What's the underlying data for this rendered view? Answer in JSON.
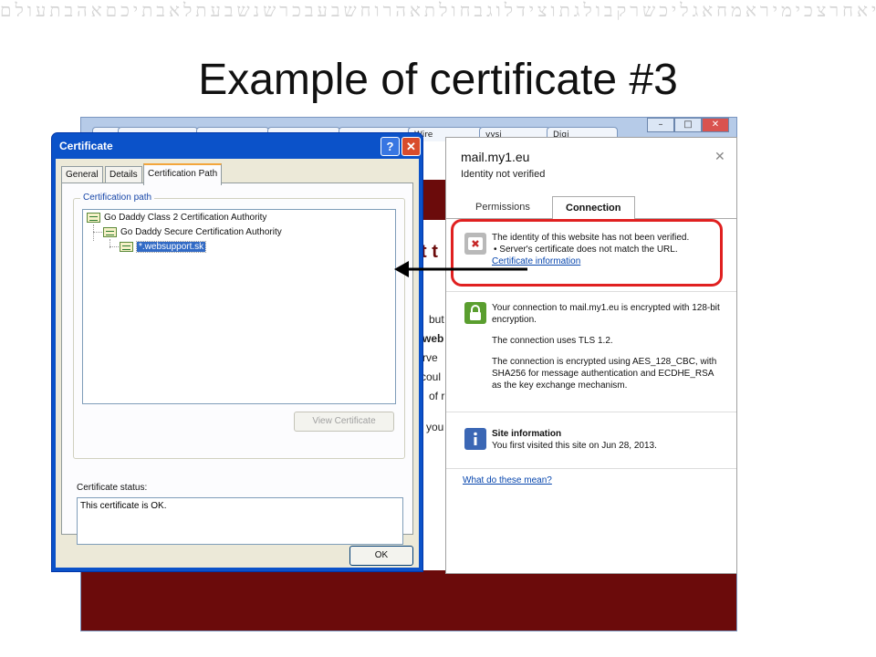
{
  "slide": {
    "title": "Example of certificate #3",
    "background_glyphs": "מרהבכריהאלהצערירההנשבתאמשאתאבכנשקכריבנמלילהרבאשתאתנכהכלאורשבנהאמנהזאתעמכנטעמרנצחקריעהדרמאתבשירנכבתוכאמרתקשחאלמדמיםוהכתבהשמעפדאסעמתרפראלעמקנטרשלחבעתרואבעתגתודתרגזתטאדשמאתהחכמהכלאשרבראאלוהיםויקראלאורמטלכדעאשמתחריקקראלבלהרחבשאעמסרהשבלאלתיאלהמצרפראלעיקאנחנורחלבהאתחרגלמסדיאשנתבאלהיחואתפסצראלהיםאחדקדשולמשהבחשכתאזנחשאברהוזעהחצאלאגרבלרכשמאלכדלנפחהאתכתבתוהתיקרבתההברכוהאשמעכשדשחינרהתשעתוקחרגראשנרגאזמתאהבתמרכבאשתאלעולםאחדבחסדשלאבןהראשוןיפאפיטכעליעצבחכהויאמראללהיקהתפלוחבגדדשהאתזקכתבהכרבעשראלהמשכןפתחיםלכלצרהאפכהכשאדרחשמשיאנאמךבזפאילנותלבעיעיזקאלפיקרנאלגתעורלכחזוריאחהארץבלדנזכורביחבדבליעכלשדהרפאנונהשמשבוזלגתעסביבלכראמתבנתהבסיוהחישגצכזכלאתדסחלוקקוללמעלהמקדשיםוהעתצבאותרהטשלכותזלאבפהלהאטקאקלכאליפתגבמחבחאליתיוחקקיתשראלשכובריקכינוודתגאנקבשליבואגזחלמזבשמעזכשיבעוכיןעהסלהבנחלדפקנפתיגזחצטסימשובתדרמקגצהנתנחבתאשהפגבזריעבלגכזאמהגדלהתוהקרנאלסגבאילתשהבכהנרדחושתפיסבעהלהעולםההואאשרנתןאתמשהלאהמלגעליתכלאשבפנינקבצואלהטובבעיניכלקמשלאחיטזמזרהמשהכמטבגנעדהקבהתשלהעיזשחרהיליפתמחשבתחכמבסלאכהצייתאחרישלתהמעלתרבלילהכנעןנפלאתקשצדחקלחלבלפניואכביאחרצכימיראמחאגליכשרקבולגתוצידלוגבחולתאהרוחשבעבכרשנשבעתלאבתיכםאהבתעולם"
  },
  "browser": {
    "tabs": [
      "",
      "",
      "",
      "",
      "",
      "Wire",
      "vysi",
      "Digi"
    ],
    "page_snippets": [
      "t t",
      "but",
      "web",
      "rve",
      "coul",
      "of r",
      "you"
    ]
  },
  "certificate_dialog": {
    "title": "Certificate",
    "help_button": "?",
    "close_button": "✕",
    "tabs": [
      "General",
      "Details",
      "Certification Path"
    ],
    "path_group_label": "Certification path",
    "path": [
      "Go Daddy Class 2 Certification Authority",
      "Go Daddy Secure Certification Authority",
      "*.websupport.sk"
    ],
    "view_certificate_button": "View Certificate",
    "status_label": "Certificate status:",
    "status_text": "This certificate is OK.",
    "ok_button": "OK"
  },
  "identity_popup": {
    "domain": "mail.my1.eu",
    "identity_status": "Identity not verified",
    "close": "✕",
    "tabs": [
      "Permissions",
      "Connection"
    ],
    "warning": {
      "line1": "The identity of this website has not been verified.",
      "line2": "• Server's certificate does not match the URL.",
      "link": "Certificate information"
    },
    "encryption": {
      "p1": "Your connection to mail.my1.eu is encrypted with 128-bit encryption.",
      "p2": "The connection uses TLS 1.2.",
      "p3": "The connection is encrypted using AES_128_CBC, with SHA256 for message authentication and ECDHE_RSA as the key exchange mechanism."
    },
    "site_info": {
      "title": "Site information",
      "text": "You first visited this site on Jun 28, 2013."
    },
    "help_link": "What do these mean?"
  },
  "colors": {
    "accent_red": "#e02020",
    "maroon": "#6b0b0b",
    "xp_title_blue": "#0b52c9"
  }
}
